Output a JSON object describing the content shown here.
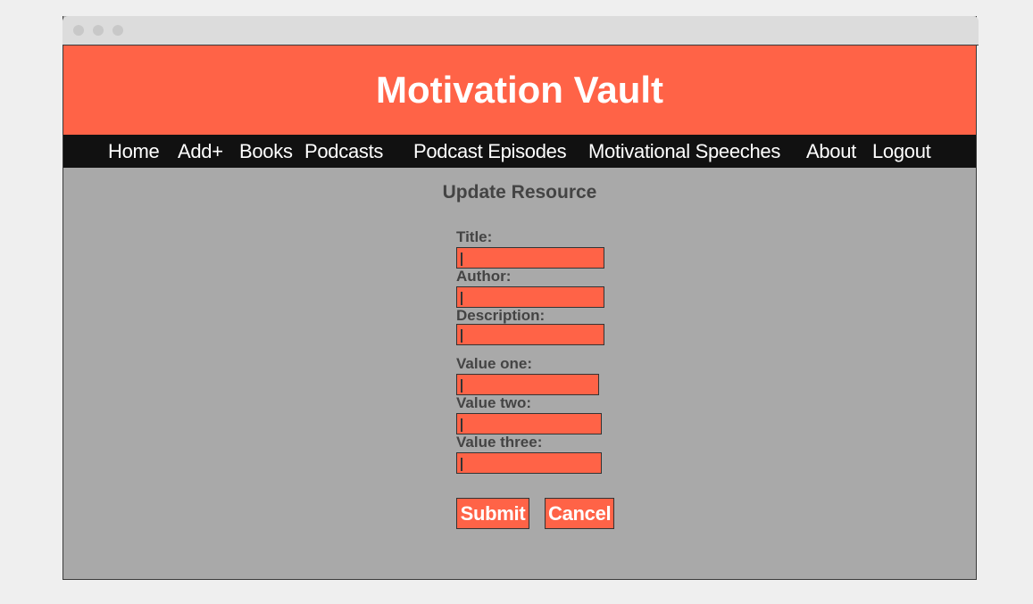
{
  "app": {
    "title": "Motivation Vault"
  },
  "nav": {
    "home": "Home",
    "add": "Add+",
    "books": "Books",
    "podcasts": "Podcasts",
    "podcast_episodes": "Podcast Episodes",
    "motivational_speeches": "Motivational Speeches",
    "about": "About",
    "logout": "Logout"
  },
  "page": {
    "title": "Update Resource"
  },
  "form": {
    "title": {
      "label": "Title:",
      "value": ""
    },
    "author": {
      "label": "Author:",
      "value": ""
    },
    "description": {
      "label": "Description:",
      "value": ""
    },
    "value_one": {
      "label": "Value one:",
      "value": ""
    },
    "value_two": {
      "label": "Value two:",
      "value": ""
    },
    "value_three": {
      "label": "Value three:",
      "value": ""
    },
    "submit_label": "Submit",
    "cancel_label": "Cancel"
  },
  "colors": {
    "accent": "#ff6347",
    "navbar": "#111111",
    "background": "#a9a9a9",
    "label_text": "#444444"
  }
}
